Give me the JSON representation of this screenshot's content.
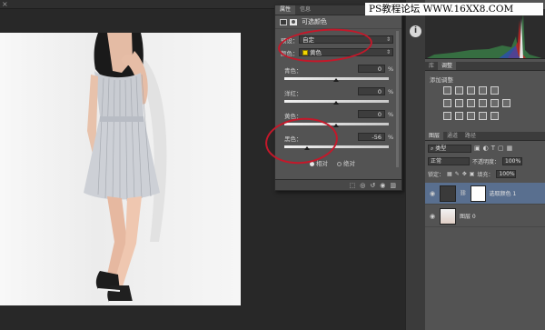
{
  "watermark": "PS教程论坛 WWW.16XX8.COM",
  "document_tab": {
    "close_glyph": "×"
  },
  "properties": {
    "tabs": [
      "属性",
      "信息"
    ],
    "active_tab": 0,
    "title": "可选颜色",
    "preset_label": "预设：",
    "preset_value": "自定",
    "colors_label": "颜色：",
    "colors_value": "黄色",
    "colors_swatch": "#f2d600",
    "sliders": [
      {
        "label": "青色：",
        "value": "0",
        "unit": "%",
        "position": 0.5
      },
      {
        "label": "洋红：",
        "value": "0",
        "unit": "%",
        "position": 0.5
      },
      {
        "label": "黄色：",
        "value": "0",
        "unit": "%",
        "position": 0.5
      },
      {
        "label": "黑色：",
        "value": "-56",
        "unit": "%",
        "position": 0.22
      }
    ],
    "method_relative": "相对",
    "method_absolute": "绝对",
    "selected_method": "relative"
  },
  "strip": {
    "info_icon": "i"
  },
  "right_panel": {
    "adjust_tabs": [
      "库",
      "调整"
    ],
    "adjust_title": "添加调整",
    "layers_tabs": [
      "图层",
      "通道",
      "路径"
    ],
    "filter_kind": "类型",
    "blend_mode": "正常",
    "opacity_label": "不透明度：",
    "opacity_value": "100%",
    "lock_label": "锁定：",
    "fill_label": "填充：",
    "fill_value": "100%",
    "layers": [
      {
        "name": "选取颜色 1",
        "active": true
      },
      {
        "name": "图层 0",
        "active": false
      }
    ]
  },
  "colors": {
    "annotation_red": "#c4182a",
    "panel_bg": "#535353",
    "active_layer": "#596f8f"
  }
}
